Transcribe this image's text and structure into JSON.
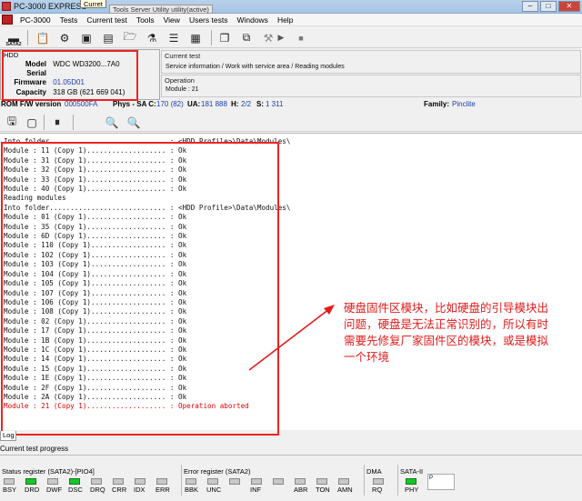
{
  "window": {
    "title": "PC-3000 EXPRESS",
    "tooltip": "Curret",
    "tooltip2": "Tools  Server  Utility utility(active)",
    "controls": [
      "–",
      "□",
      "✕"
    ]
  },
  "menu": [
    "PC-3000",
    "Tests",
    "Current test",
    "Tools",
    "View",
    "Users tests",
    "Windows",
    "Help"
  ],
  "toolbar": {
    "sata_label": "SATA2"
  },
  "hdd": {
    "header": "HDD",
    "model_label": "Model",
    "model_value": "WDC WD3200...7A0",
    "serial_label": "Serial",
    "serial_value": "",
    "firmware_label": "Firmware",
    "firmware_value": "01.05D01",
    "capacity_label": "Capacity",
    "capacity_value": "318 GB (621 669 041)"
  },
  "current_test": {
    "label": "Current test",
    "value": "Service information / Work with service area / Reading modules"
  },
  "operation": {
    "label": "Operation",
    "value": "Module : 21"
  },
  "rom": {
    "rom_label": "ROM F/W version",
    "rom_value": "000500FA",
    "phys_label": "Phys - SA C:",
    "phys_value": "170 (82)",
    "ua_label": "UA:",
    "ua_value": "181 888",
    "h_label": "H:",
    "h_value": "2/2",
    "s_label": "S:",
    "s_value": "1 311",
    "family_label": "Family:",
    "family_value": "Pinclite"
  },
  "log": {
    "lines": [
      "Into folder............................ : <HDD Profile>\\Data\\Modules\\",
      "Module : 11 (Copy 1)................... : Ok",
      "Module : 31 (Copy 1)................... : Ok",
      "Module : 32 (Copy 1)................... : Ok",
      "Module : 33 (Copy 1)................... : Ok",
      "Module : 40 (Copy 1)................... : Ok",
      "Reading modules",
      "Into folder............................ : <HDD Profile>\\Data\\Modules\\",
      "Module : 01 (Copy 1)................... : Ok",
      "Module : 35 (Copy 1)................... : Ok",
      "Module : 6D (Copy 1)................... : Ok",
      "Module : 110 (Copy 1).................. : Ok",
      "Module : 102 (Copy 1).................. : Ok",
      "Module : 103 (Copy 1).................. : Ok",
      "Module : 104 (Copy 1).................. : Ok",
      "Module : 105 (Copy 1).................. : Ok",
      "Module : 107 (Copy 1).................. : Ok",
      "Module : 106 (Copy 1).................. : Ok",
      "Module : 108 (Copy 1).................. : Ok",
      "Module : 02 (Copy 1)................... : Ok",
      "Module : 17 (Copy 1)................... : Ok",
      "Module : 1B (Copy 1)................... : Ok",
      "Module : 1C (Copy 1)................... : Ok",
      "Module : 14 (Copy 1)................... : Ok",
      "Module : 15 (Copy 1)................... : Ok",
      "Module : 1E (Copy 1)................... : Ok",
      "Module : 2F (Copy 1)................... : Ok",
      "Module : 2A (Copy 1)................... : Ok",
      "Module : 21 (Copy 1)................... : Operation aborted"
    ],
    "error_line_index": 28
  },
  "annotation": {
    "text": "硬盘固件区模块，比如硬盘的引导模块出问题，硬盘是无法正常识别的，所以有时需要先修复厂家固件区的模块，或是模拟一个环境",
    "color": "#e21b1b"
  },
  "bottom": {
    "log_tab": "Log",
    "progress_label": "Current test progress"
  },
  "status": {
    "status_register_title": "Status register (SATA2)-[PIO4]",
    "status_leds": [
      {
        "label": "BSY",
        "on": false
      },
      {
        "label": "DRD",
        "on": true
      },
      {
        "label": "DWF",
        "on": false
      },
      {
        "label": "DSC",
        "on": true
      },
      {
        "label": "DRQ",
        "on": false
      },
      {
        "label": "CRR",
        "on": false
      },
      {
        "label": "IDX",
        "on": false
      },
      {
        "label": "ERR",
        "on": false
      }
    ],
    "error_register_title": "Error register (SATA2)",
    "error_leds": [
      {
        "label": "BBK",
        "on": false
      },
      {
        "label": "UNC",
        "on": false
      },
      {
        "label": "",
        "on": false
      },
      {
        "label": "INF",
        "on": false
      },
      {
        "label": "",
        "on": false
      },
      {
        "label": "ABR",
        "on": false
      },
      {
        "label": "TON",
        "on": false
      },
      {
        "label": "AMN",
        "on": false
      }
    ],
    "dma_title": "DMA",
    "dma_leds": [
      {
        "label": "RQ",
        "on": false
      }
    ],
    "sata_title": "SATA-II",
    "sata_leds": [
      {
        "label": "PHY",
        "on": true
      }
    ],
    "p_box": "P"
  },
  "colors": {
    "led_on": "#18c62a",
    "highlight": "#e22222",
    "link_blue": "#1b3fa8"
  }
}
